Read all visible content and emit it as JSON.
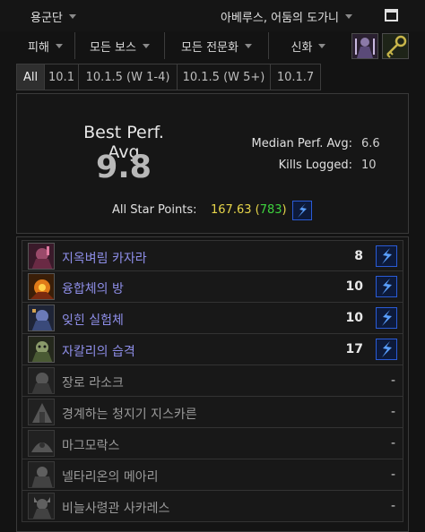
{
  "header": {
    "zone": "용군단",
    "character": "아베루스, 어둠의 도가니"
  },
  "filters": [
    "피해",
    "모든 보스",
    "모든 전문화",
    "신화"
  ],
  "tabs": [
    {
      "label": "All",
      "active": true
    },
    {
      "label": "10.1",
      "active": false
    },
    {
      "label": "10.1.5 (W 1-4)",
      "active": false
    },
    {
      "label": "10.1.5 (W 5+)",
      "active": false
    },
    {
      "label": "10.1.7",
      "active": false
    }
  ],
  "summary": {
    "best_label": "Best Perf. Avg",
    "best_value": "9.8",
    "median_label": "Median Perf. Avg:",
    "median_value": "6.6",
    "kills_label": "Kills Logged:",
    "kills_value": "10",
    "star_label": "All Star Points:",
    "star_points": "167.63",
    "star_rank": "783"
  },
  "colors": {
    "killed_boss": "#8e8ee8",
    "unkilled_boss": "#9a9a9a",
    "star_points": "#e8d64a",
    "star_rank": "#3ed33e",
    "bolt": "#2a5bd7"
  },
  "bosses": [
    {
      "name": "지옥벼림 카자라",
      "kills": "8",
      "icon": "bolt-icon"
    },
    {
      "name": "융합체의 방",
      "kills": "10",
      "icon": "bolt-icon"
    },
    {
      "name": "잊힌 실험체",
      "kills": "10",
      "icon": "bolt-icon"
    },
    {
      "name": "자칼리의 습격",
      "kills": "17",
      "icon": "bolt-icon"
    },
    {
      "name": "장로 라소크",
      "kills": "-",
      "icon": ""
    },
    {
      "name": "경계하는 청지기 지스카른",
      "kills": "-",
      "icon": ""
    },
    {
      "name": "마그모락스",
      "kills": "-",
      "icon": ""
    },
    {
      "name": "넬타리온의 메아리",
      "kills": "-",
      "icon": ""
    },
    {
      "name": "비늘사령관 사카레스",
      "kills": "-",
      "icon": ""
    }
  ]
}
